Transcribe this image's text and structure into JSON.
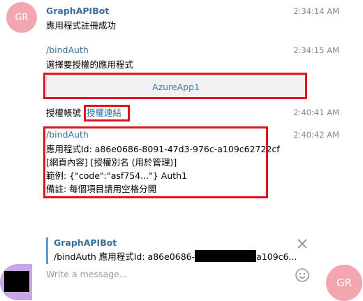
{
  "bot": {
    "name": "GraphAPIBot",
    "avatar_initials": "GR",
    "avatar_color": "#f4a6b0"
  },
  "messages": [
    {
      "time": "2:34:14 AM",
      "text": "應用程式註冊成功"
    },
    {
      "time": "2:34:15 AM",
      "command": "/bindAuth",
      "text": "選擇要授權的應用程式",
      "keyboard_button": "AzureApp1"
    },
    {
      "time": "2:40:41 AM",
      "text": "授權帳號",
      "link": "授權連結"
    },
    {
      "time": "2:40:42 AM",
      "command": "/bindAuth",
      "lines": [
        "應用程式Id: a86e0686-8091-47d3-976c-a109c62722cf",
        "[網頁內容] [授權別名 (用於管理)]",
        "範例: {\"code\":\"asf754...\"} Auth1",
        "備註: 每個項目請用空格分開"
      ]
    }
  ],
  "reply_preview": {
    "sender": "GraphAPIBot",
    "text_prefix": "/bindAuth 應用程式Id: a86e0686-",
    "text_suffix": "a109c6..."
  },
  "composer": {
    "placeholder": "Write a message...",
    "user_avatar_color": "#c9a6e6",
    "right_avatar_initials": "GR",
    "right_avatar_color": "#f4a6b0"
  },
  "colors": {
    "highlight": "#e2121d",
    "link": "#3a6d99"
  }
}
